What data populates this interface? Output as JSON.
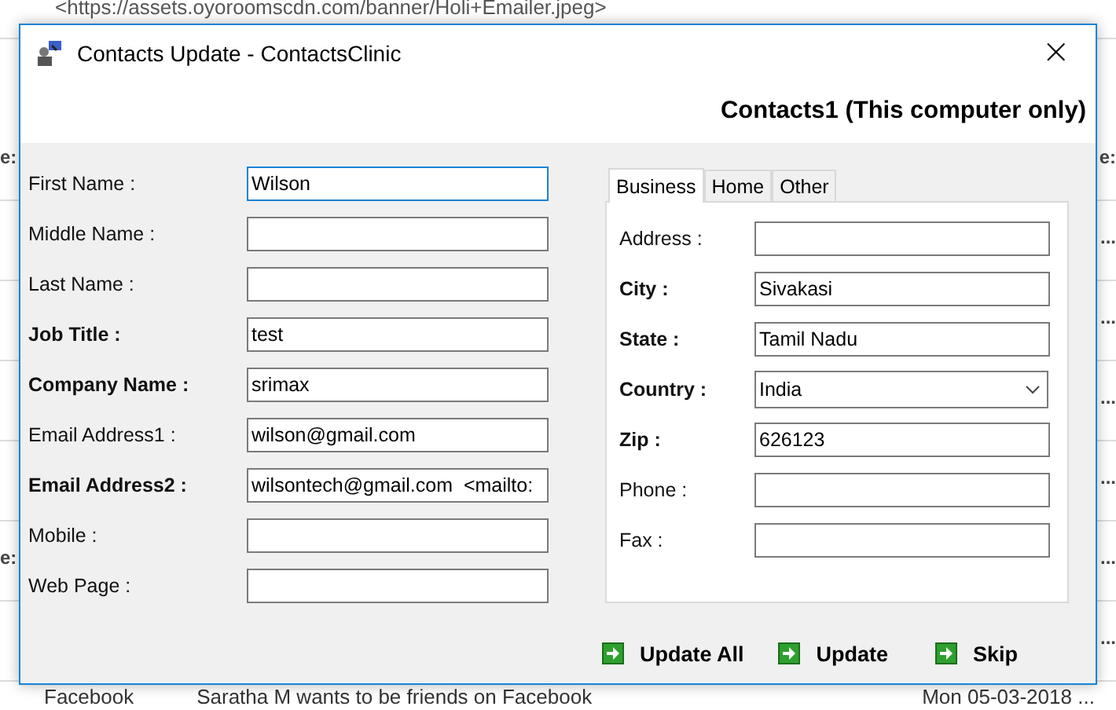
{
  "background": {
    "link": "<https://assets.oyoroomscdn.com/banner/Holi+Emailer.jpeg>",
    "rows": [
      {
        "left": "e:",
        "right": "e:"
      },
      {
        "right": "..."
      },
      {
        "right": "..."
      },
      {
        "right": "..."
      },
      {
        "right": "..."
      },
      {
        "left": "e:",
        "right": "..."
      },
      {
        "right": "..."
      }
    ],
    "last_row": {
      "source": "Facebook",
      "subject": "Saratha M wants to be friends on Facebook",
      "date": "Mon 05-03-2018 ..."
    }
  },
  "window": {
    "title": "Contacts Update - ContactsClinic",
    "close": "×",
    "header": "Contacts1 (This computer only)"
  },
  "fields": [
    {
      "label": "First Name :",
      "value": "Wilson",
      "bold": false,
      "focused": true
    },
    {
      "label": "Middle Name :",
      "bold": false,
      "focused": false
    },
    {
      "label": "Last Name :",
      "bold": false,
      "focused": false
    },
    {
      "label": "Job Title :",
      "value": "test",
      "bold": true,
      "focused": false
    },
    {
      "label": "Company Name :",
      "value": "srimax",
      "bold": true,
      "focused": false
    },
    {
      "label": "Email Address1 :",
      "value": "wilson@gmail.com",
      "bold": false,
      "focused": false
    },
    {
      "label": "Email Address2 :",
      "value": "wilsontech@gmail.com  <mailto:",
      "bold": true,
      "focused": false
    },
    {
      "label": "Mobile :",
      "bold": false,
      "focused": false
    },
    {
      "label": "Web Page :",
      "bold": false,
      "focused": false
    }
  ],
  "tabs": [
    {
      "label": "Business",
      "selected": true
    },
    {
      "label": "Home",
      "selected": false
    },
    {
      "label": "Other",
      "selected": false
    }
  ],
  "address": [
    {
      "kind": "text",
      "label": "Address :",
      "bold": false
    },
    {
      "kind": "text",
      "label": "City :",
      "value": "Sivakasi",
      "bold": true
    },
    {
      "kind": "text",
      "label": "State :",
      "value": "Tamil Nadu",
      "bold": true
    },
    {
      "kind": "select",
      "label": "Country :",
      "value": "India",
      "bold": true
    },
    {
      "kind": "text",
      "label": "Zip :",
      "value": "626123",
      "bold": true
    },
    {
      "kind": "text",
      "label": "Phone :",
      "bold": false
    },
    {
      "kind": "text",
      "label": "Fax :",
      "bold": false
    }
  ],
  "buttons": [
    "Update All",
    "Update",
    "Skip"
  ]
}
